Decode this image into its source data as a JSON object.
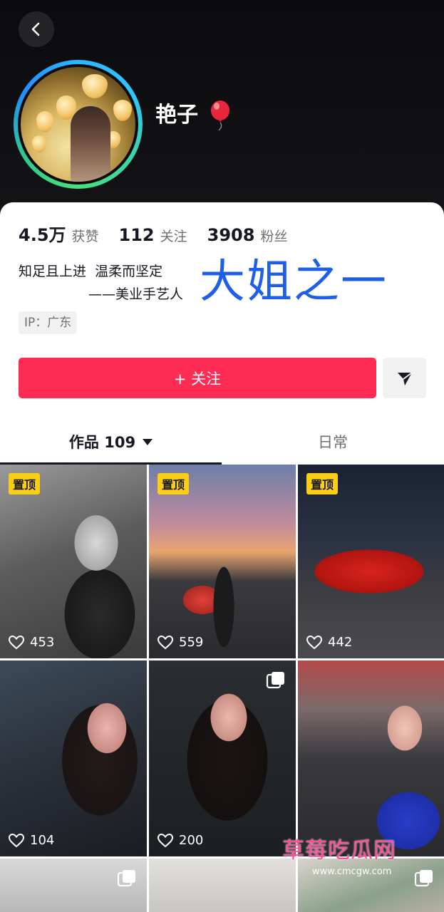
{
  "header": {
    "back_icon": "chevron-left-icon",
    "username": "艳子",
    "username_emoji": "balloon-icon"
  },
  "stats": [
    {
      "value": "4.5万",
      "label": "获赞"
    },
    {
      "value": "112",
      "label": "关注"
    },
    {
      "value": "3908",
      "label": "粉丝"
    }
  ],
  "bio": {
    "line1": "知足且上进  温柔而坚定",
    "line2": "——美业手艺人"
  },
  "overlay_text": "大姐之一",
  "ip_tag": "IP：广东",
  "actions": {
    "follow_label": "+ 关注",
    "share_icon": "send-icon"
  },
  "tabs": {
    "works_label": "作品 109",
    "daily_label": "日常"
  },
  "grid": {
    "items": [
      {
        "pinned": "置顶",
        "likes": "453"
      },
      {
        "pinned": "置顶",
        "likes": "559"
      },
      {
        "pinned": "置顶",
        "likes": "442"
      },
      {
        "likes": "104"
      },
      {
        "likes": "200",
        "multi": "multi-image-icon"
      },
      {
        "likes": ""
      }
    ]
  },
  "watermark": "草莓吃瓜网",
  "url_mark": "www.cmcgw.com",
  "colors": {
    "accent": "#fe2c55",
    "pin": "#face15",
    "overlay": "#1f5fe8",
    "watermark": "#ff4d94"
  }
}
